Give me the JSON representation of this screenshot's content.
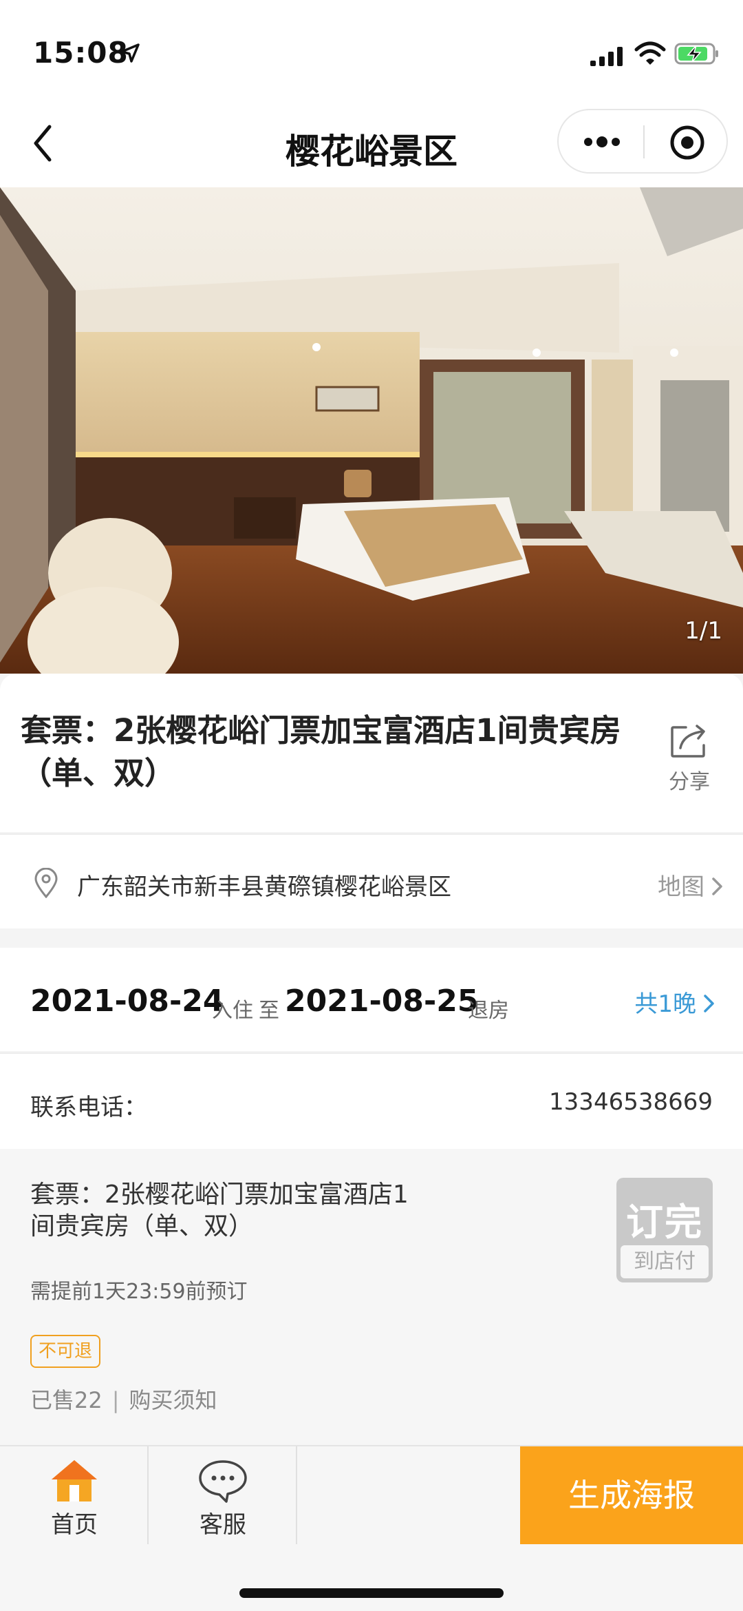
{
  "status_bar": {
    "time": "15:08"
  },
  "nav": {
    "title": "樱花峪景区"
  },
  "hero": {
    "counter": "1/1"
  },
  "product": {
    "title": "套票：2张樱花峪门票加宝富酒店1间贵宾房（单、双）",
    "share_label": "分享"
  },
  "address": {
    "text": "广东韶关市新丰县黄磜镇樱花峪景区",
    "map_label": "地图"
  },
  "dates": {
    "checkin_date": "2021-08-24",
    "checkin_label": "入住",
    "to_label": "至",
    "checkout_date": "2021-08-25",
    "checkout_label": "退房",
    "nights": "共1晚"
  },
  "contact": {
    "label": "联系电话：",
    "phone": "13346538669"
  },
  "room": {
    "title": "套票：2张樱花峪门票加宝富酒店1间贵宾房（单、双）",
    "note": "需提前1天23:59前预订",
    "badge": "不可退",
    "sold": "已售22",
    "separator": "|",
    "notice": "购买须知",
    "status_top": "订完",
    "status_bottom": "到店付"
  },
  "tabs": {
    "home": "首页",
    "service": "客服",
    "poster": "生成海报"
  },
  "colors": {
    "accent": "#fba31b",
    "link": "#3b9ad6",
    "badge": "#f0a020"
  }
}
